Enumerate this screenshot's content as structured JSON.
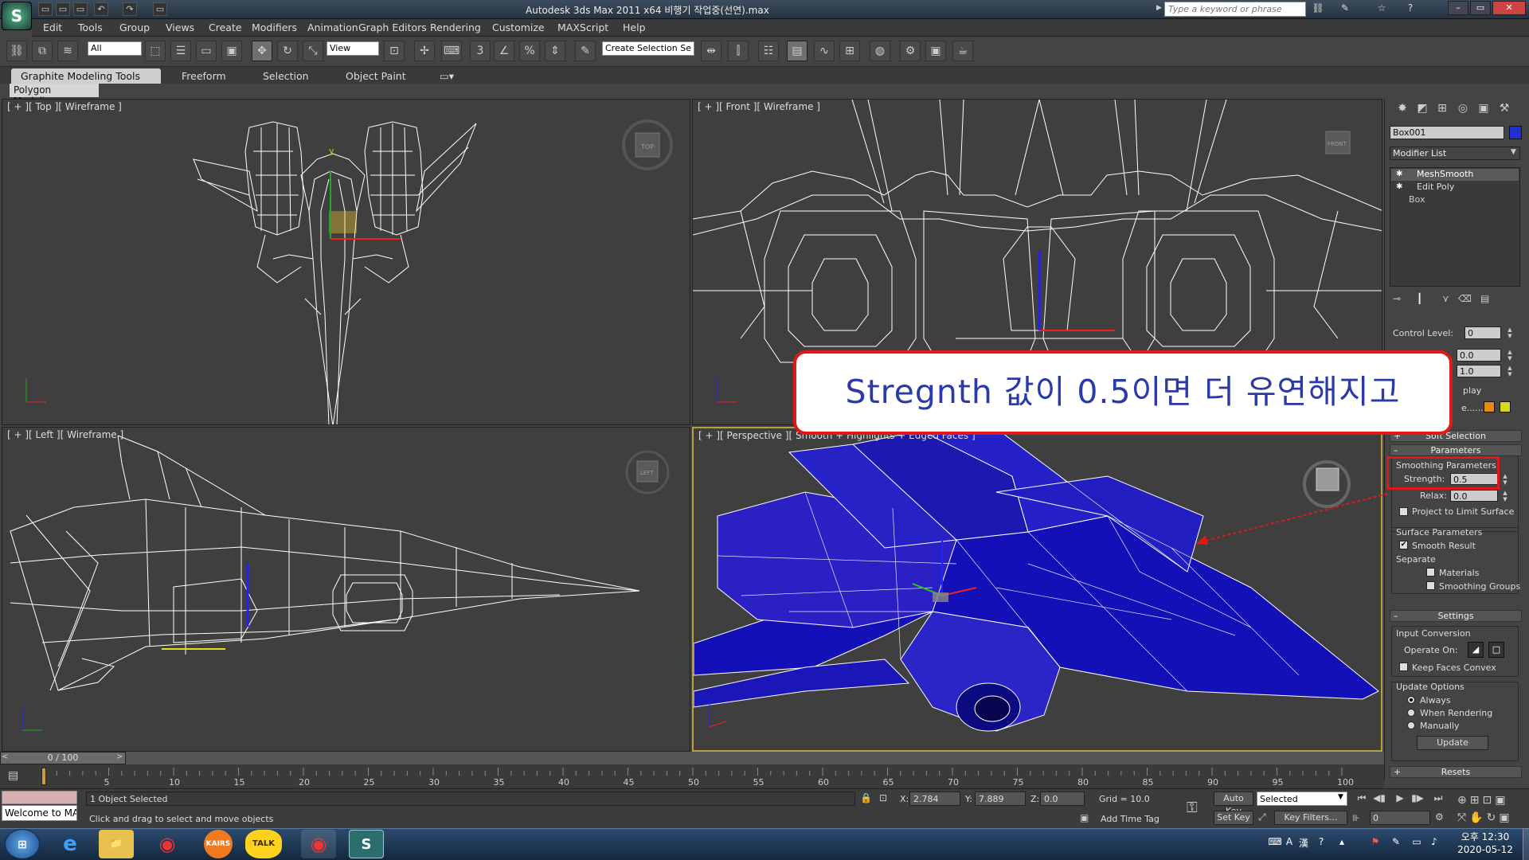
{
  "titlebar": {
    "logo": "S",
    "app_title": "Autodesk 3ds Max  2011 x64      비행기 작업중(선연).max",
    "search_placeholder": "Type a keyword or phrase",
    "quick_access": [
      "▭",
      "▭",
      "▭",
      "↶",
      "↷",
      "▭"
    ],
    "right_icons": [
      "⛓",
      "✎",
      "☆",
      "?"
    ],
    "window_buttons": [
      "–",
      "▭",
      "✕"
    ]
  },
  "menubar": [
    "Edit",
    "Tools",
    "Group",
    "Views",
    "Create",
    "Modifiers",
    "Animation",
    "Graph Editors",
    "Rendering",
    "Customize",
    "MAXScript",
    "Help"
  ],
  "toolbar": {
    "selection_filter": "All",
    "ref_coord": "View",
    "named_selection": "Create Selection Se"
  },
  "ribbon": {
    "tabs": [
      "Graphite Modeling Tools",
      "Freeform",
      "Selection",
      "Object Paint"
    ],
    "panel": "Polygon Modeling"
  },
  "viewports": {
    "top": "[ + ][ Top ][ Wireframe ]",
    "front": "[ + ][ Front ][ Wireframe ]",
    "left": "[ + ][ Left ][ Wireframe ]",
    "perspective": "[ + ][ Perspective ][ Smooth + Highlights + Edged Faces ]",
    "cube_top": "TOP",
    "cube_front": "FRONT",
    "cube_left": "LEFT"
  },
  "command_panel": {
    "object_name": "Box001",
    "object_color": "#2030d0",
    "modifier_list": "Modifier List",
    "stack": [
      "MeshSmooth",
      "Edit Poly",
      "Box"
    ],
    "control_level_label": "Control Level:",
    "control_level_value": "0",
    "field_a": "0.0",
    "field_b": "1.0",
    "display_label": "play",
    "color_label": "e........",
    "swatch1": "#e58a10",
    "swatch2": "#d8d820",
    "soft_selection": "Soft Selection",
    "parameters": "Parameters",
    "smoothing_params": "Smoothing Parameters",
    "strength_label": "Strength:",
    "strength_value": "0.5",
    "relax_label": "Relax:",
    "relax_value": "0.0",
    "project_limit": "Project to Limit Surface",
    "surface_params": "Surface Parameters",
    "smooth_result": "Smooth Result",
    "separate": "Separate",
    "materials": "Materials",
    "smoothing_groups": "Smoothing Groups",
    "settings": "Settings",
    "input_conversion": "Input Conversion",
    "operate_on": "Operate On:",
    "keep_faces_convex": "Keep Faces Convex",
    "update_options": "Update Options",
    "always": "Always",
    "when_rendering": "When Rendering",
    "manually": "Manually",
    "update_btn": "Update",
    "resets": "Resets"
  },
  "timeline": {
    "slider": "0 / 100",
    "ticks": [
      "5",
      "10",
      "15",
      "20",
      "25",
      "30",
      "35",
      "40",
      "45",
      "50",
      "55",
      "60",
      "65",
      "70",
      "75",
      "80",
      "85",
      "90",
      "95",
      "100"
    ]
  },
  "status": {
    "welcome": "Welcome to MA",
    "selected": "1 Object Selected",
    "prompt": "Click and drag to select and move objects",
    "x_label": "X:",
    "x": "2.784",
    "y_label": "Y:",
    "y": "7.889",
    "z_label": "Z:",
    "z": "0.0",
    "grid": "Grid = 10.0",
    "add_time_tag": "Add Time Tag",
    "auto_key": "Auto Key",
    "set_key": "Set Key",
    "selected_dropdown": "Selected",
    "key_filters": "Key Filters...",
    "frame": "0"
  },
  "taskbar": {
    "apps": [
      "e",
      "📁",
      "◉",
      "KAIRS",
      "TALK",
      "◉",
      "S"
    ],
    "tray": [
      "⌨",
      "A",
      "漢",
      "?",
      "▴",
      "⚑",
      "✎",
      "▭",
      "♪"
    ],
    "time": "오후 12:30",
    "date": "2020-05-12"
  },
  "annotation": {
    "callout": "Stregnth 값이 0.5이면 더 유연해지고"
  }
}
